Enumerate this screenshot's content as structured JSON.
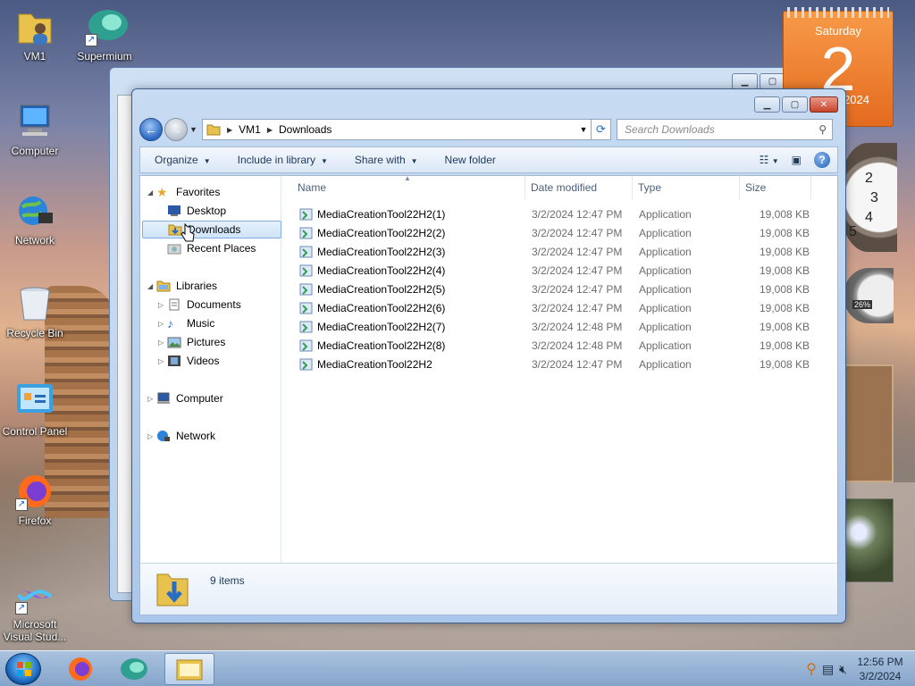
{
  "desktop": {
    "icons": [
      {
        "label": "VM1"
      },
      {
        "label": "Supermium"
      },
      {
        "label": "Computer"
      },
      {
        "label": "Network"
      },
      {
        "label": "Recycle Bin"
      },
      {
        "label": "Control Panel"
      },
      {
        "label": "Firefox"
      },
      {
        "label": "Microsoft Visual Stud..."
      }
    ]
  },
  "calendar_gadget": {
    "weekday": "Saturday",
    "day": "2",
    "year": "2024"
  },
  "meter_gadget": {
    "value": "26%"
  },
  "window": {
    "address": {
      "segments": [
        "VM1",
        "Downloads"
      ]
    },
    "search_placeholder": "Search Downloads",
    "toolbar": {
      "organize": "Organize",
      "include_in_library": "Include in library",
      "share_with": "Share with",
      "new_folder": "New folder"
    },
    "nav": {
      "favorites": "Favorites",
      "desktop": "Desktop",
      "downloads": "Downloads",
      "recent_places": "Recent Places",
      "libraries": "Libraries",
      "documents": "Documents",
      "music": "Music",
      "pictures": "Pictures",
      "videos": "Videos",
      "computer": "Computer",
      "network": "Network"
    },
    "columns": {
      "name": "Name",
      "date": "Date modified",
      "type": "Type",
      "size": "Size"
    },
    "files": [
      {
        "name": "MediaCreationTool22H2(1)",
        "date": "3/2/2024 12:47 PM",
        "type": "Application",
        "size": "19,008 KB"
      },
      {
        "name": "MediaCreationTool22H2(2)",
        "date": "3/2/2024 12:47 PM",
        "type": "Application",
        "size": "19,008 KB"
      },
      {
        "name": "MediaCreationTool22H2(3)",
        "date": "3/2/2024 12:47 PM",
        "type": "Application",
        "size": "19,008 KB"
      },
      {
        "name": "MediaCreationTool22H2(4)",
        "date": "3/2/2024 12:47 PM",
        "type": "Application",
        "size": "19,008 KB"
      },
      {
        "name": "MediaCreationTool22H2(5)",
        "date": "3/2/2024 12:47 PM",
        "type": "Application",
        "size": "19,008 KB"
      },
      {
        "name": "MediaCreationTool22H2(6)",
        "date": "3/2/2024 12:47 PM",
        "type": "Application",
        "size": "19,008 KB"
      },
      {
        "name": "MediaCreationTool22H2(7)",
        "date": "3/2/2024 12:48 PM",
        "type": "Application",
        "size": "19,008 KB"
      },
      {
        "name": "MediaCreationTool22H2(8)",
        "date": "3/2/2024 12:48 PM",
        "type": "Application",
        "size": "19,008 KB"
      },
      {
        "name": "MediaCreationTool22H2",
        "date": "3/2/2024 12:47 PM",
        "type": "Application",
        "size": "19,008 KB"
      }
    ],
    "details": {
      "item_count": "9 items"
    }
  },
  "taskbar": {
    "time": "12:56 PM",
    "date": "3/2/2024"
  }
}
